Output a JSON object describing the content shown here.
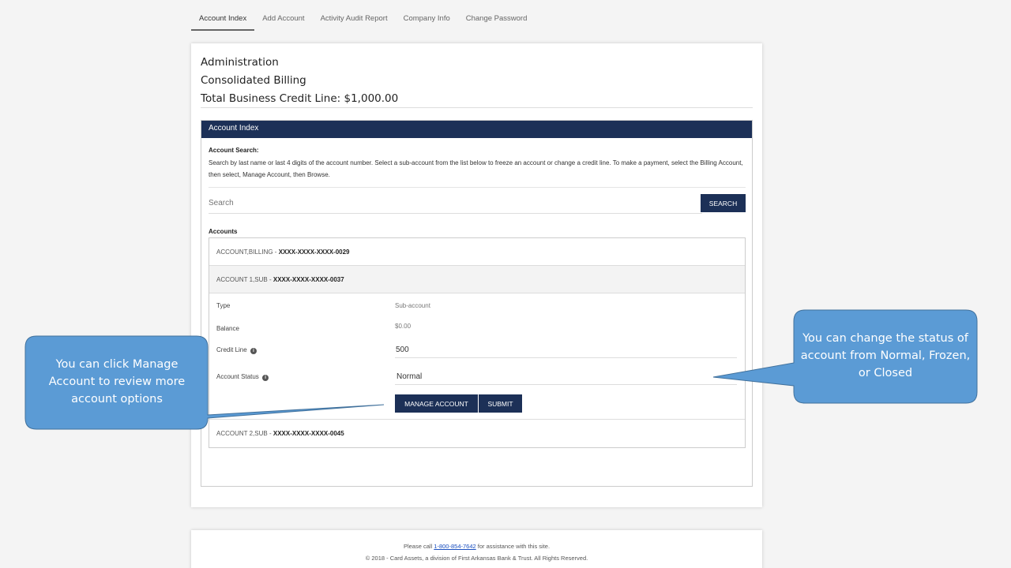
{
  "nav": {
    "items": [
      "Account Index",
      "Add Account",
      "Activity Audit Report",
      "Company Info",
      "Change Password"
    ]
  },
  "header": {
    "line1": "Administration",
    "line2": "Consolidated Billing",
    "line3": "Total Business Credit Line: $1,000.00"
  },
  "panel": {
    "title": "Account Index",
    "search_title": "Account Search:",
    "search_desc": "Search by last name or last 4 digits of the account number. Select a sub-account from the list below to freeze an account or change a credit line. To make a payment, select the Billing Account, then select, Manage Account, then Browse.",
    "search_placeholder": "Search",
    "search_button": "SEARCH",
    "accounts_label": "Accounts"
  },
  "accounts": [
    {
      "name": "ACCOUNT,BILLING - ",
      "number": "XXXX-XXXX-XXXX-0029"
    },
    {
      "name": "ACCOUNT 1,SUB - ",
      "number": "XXXX-XXXX-XXXX-0037"
    },
    {
      "name": "ACCOUNT 2,SUB - ",
      "number": "XXXX-XXXX-XXXX-0045"
    }
  ],
  "detail": {
    "type_label": "Type",
    "type_value": "Sub-account",
    "balance_label": "Balance",
    "balance_value": "$0.00",
    "credit_label": "Credit Line",
    "credit_value": "500",
    "status_label": "Account Status",
    "status_value": "Normal",
    "manage_button": "MANAGE ACCOUNT",
    "submit_button": "SUBMIT",
    "info_glyph": "i"
  },
  "footer": {
    "call_prefix": "Please call ",
    "phone": "1-800-854-7642",
    "call_suffix": " for assistance with this site.",
    "copyright": "© 2018 - Card Assets, a division of First Arkansas Bank & Trust. All Rights Reserved."
  },
  "callouts": {
    "left_text": "You can click Manage Account to review more account options",
    "right_text": "You can change the status of account from Normal, Frozen, or Closed",
    "fill_color": "#5b9bd5",
    "stroke_color": "#41719c"
  },
  "colors": {
    "header_bar": "#1c3057",
    "link": "#1a4fbf"
  }
}
